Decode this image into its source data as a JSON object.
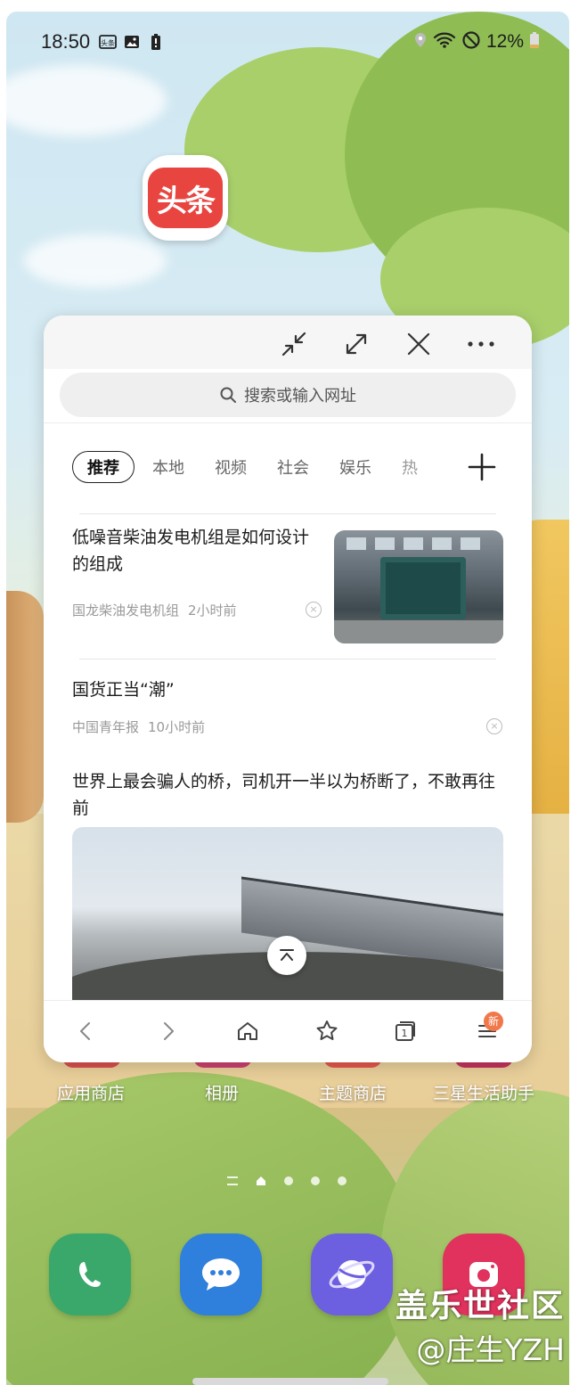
{
  "status_bar": {
    "time": "18:50",
    "notification_icons": [
      "toutiao-notification-icon",
      "image-icon",
      "battery-alert-icon"
    ],
    "system_icons": [
      "location-icon",
      "wifi-icon",
      "do-not-disturb-icon",
      "battery-icon"
    ],
    "battery_percent": "12%"
  },
  "home_app_icon": {
    "icon": "toutiao-app-icon",
    "text": "头条",
    "color": "#e84540"
  },
  "popup_browser": {
    "header_buttons": [
      "minimize-icon",
      "maximize-icon",
      "close-icon",
      "more-options-icon"
    ],
    "address_bar": {
      "placeholder": "搜索或输入网址"
    },
    "tabs": [
      {
        "label": "推荐",
        "active": true
      },
      {
        "label": "本地"
      },
      {
        "label": "视频"
      },
      {
        "label": "社会"
      },
      {
        "label": "娱乐"
      },
      {
        "label": "热"
      }
    ],
    "feed": [
      {
        "title": "低噪音柴油发电机组是如何设计的组成",
        "source": "国龙柴油发电机组",
        "time": "2小时前",
        "has_thumbnail": true
      },
      {
        "title": "国货正当“潮”",
        "source": "中国青年报",
        "time": "10小时前"
      },
      {
        "title": "世界上最会骗人的桥，司机开一半以为桥断了，不敢再往前",
        "has_image": true
      }
    ],
    "bottom_nav": [
      "back-icon",
      "forward-icon",
      "home-icon",
      "bookmark-icon",
      "tabs-icon",
      "menu-icon"
    ],
    "tabs_count": "1",
    "menu_badge": "新"
  },
  "home_apps": [
    {
      "label": "应用商店"
    },
    {
      "label": "相册"
    },
    {
      "label": "主题商店"
    },
    {
      "label": "三星生活助手"
    }
  ],
  "dock": [
    {
      "icon": "phone-icon",
      "color": "#3aa86b"
    },
    {
      "icon": "messages-icon",
      "color": "#2f7fdc"
    },
    {
      "icon": "internet-icon",
      "color": "#6c5fe0"
    },
    {
      "icon": "camera-icon",
      "color": "#e0325d"
    }
  ],
  "watermark": {
    "line1": "盖乐世社区",
    "line2": "@庄生YZH"
  }
}
